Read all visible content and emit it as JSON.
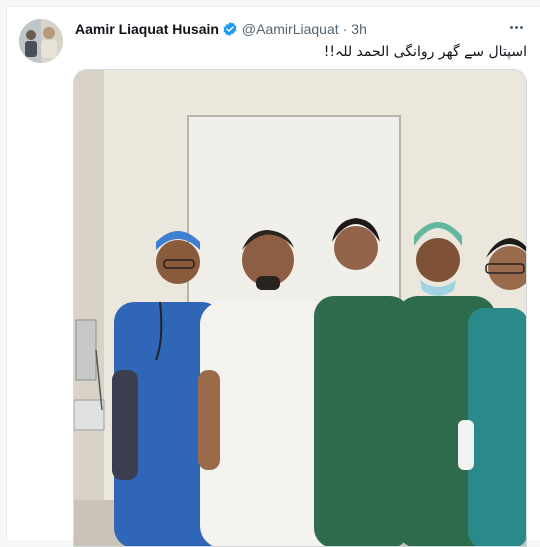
{
  "tweet": {
    "author_name": "Aamir Liaquat Husain",
    "handle": "@AamirLiaquat",
    "separator": "·",
    "time": "3h",
    "text": "اسپتال سے گھر روانگی الحمد للہ!!",
    "verified": true
  },
  "icons": {
    "verified": "verified-badge-icon",
    "more": "more-options-icon"
  },
  "colors": {
    "verified_blue": "#1d9bf0",
    "muted_text": "#536471",
    "primary_text": "#0f1419"
  }
}
